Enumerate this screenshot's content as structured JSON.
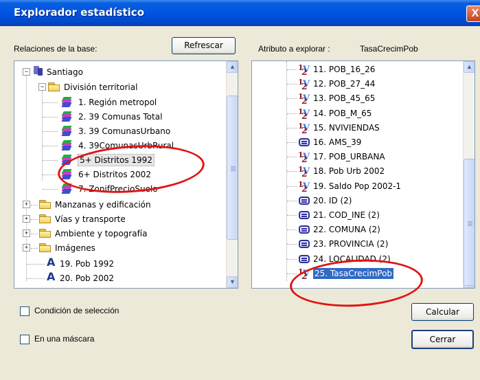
{
  "window": {
    "title": "Explorador estadístico",
    "close_glyph": "X"
  },
  "left_panel": {
    "label": "Relaciones de la base:",
    "refresh_label": "Refrescar",
    "root": "Santiago",
    "folder_open": "División territorial",
    "subitems": [
      "1. Región metropol",
      "2. 39 Comunas Total",
      "3. 39 ComunasUrbano",
      "4. 39ComunasUrbRural",
      "5+ Distritos 1992",
      "6+ Distritos 2002",
      "7. ZonifPrecioSuelo"
    ],
    "folders": [
      "Manzanas y edificación",
      "Vías y transporte",
      "Ambiente y topografía",
      "Imágenes"
    ],
    "layers": [
      "19. Pob 1992",
      "20. Pob 2002"
    ],
    "selected_item": "5+ Distritos 1992"
  },
  "right_panel": {
    "label": "Atributo a explorar :",
    "value": "TasaCrecimPob",
    "items": [
      {
        "text": "11. POB_16_26",
        "icon": "formula-icon"
      },
      {
        "text": "12. POB_27_44",
        "icon": "formula-icon"
      },
      {
        "text": "13. POB_45_65",
        "icon": "formula-icon"
      },
      {
        "text": "14. POB_M_65",
        "icon": "formula-icon"
      },
      {
        "text": "15. NVIVIENDAS",
        "icon": "formula-icon"
      },
      {
        "text": "16. AMS_39",
        "icon": "table-icon"
      },
      {
        "text": "17. POB_URBANA",
        "icon": "formula-icon"
      },
      {
        "text": "18. Pob Urb 2002",
        "icon": "formula-icon"
      },
      {
        "text": "19. Saldo Pop 2002-1",
        "icon": "formula-icon"
      },
      {
        "text": "20. ID (2)",
        "icon": "table-icon"
      },
      {
        "text": "21. COD_INE (2)",
        "icon": "table-icon"
      },
      {
        "text": "22. COMUNA (2)",
        "icon": "table-icon"
      },
      {
        "text": "23. PROVINCIA (2)",
        "icon": "table-icon"
      },
      {
        "text": "24. LOCALIDAD (2)",
        "icon": "table-icon"
      },
      {
        "text": "25. TasaCrecimPob",
        "icon": "formula-icon",
        "selected": true
      }
    ]
  },
  "options": {
    "selection_condition": "Condición de selección",
    "mask": "En una máscara"
  },
  "buttons": {
    "calculate": "Calcular",
    "close": "Cerrar"
  },
  "colors": {
    "title_bar": "#0054E3",
    "selection": "#316AC5",
    "annotation": "#E11414",
    "dialog_bg": "#ECE9D8"
  }
}
